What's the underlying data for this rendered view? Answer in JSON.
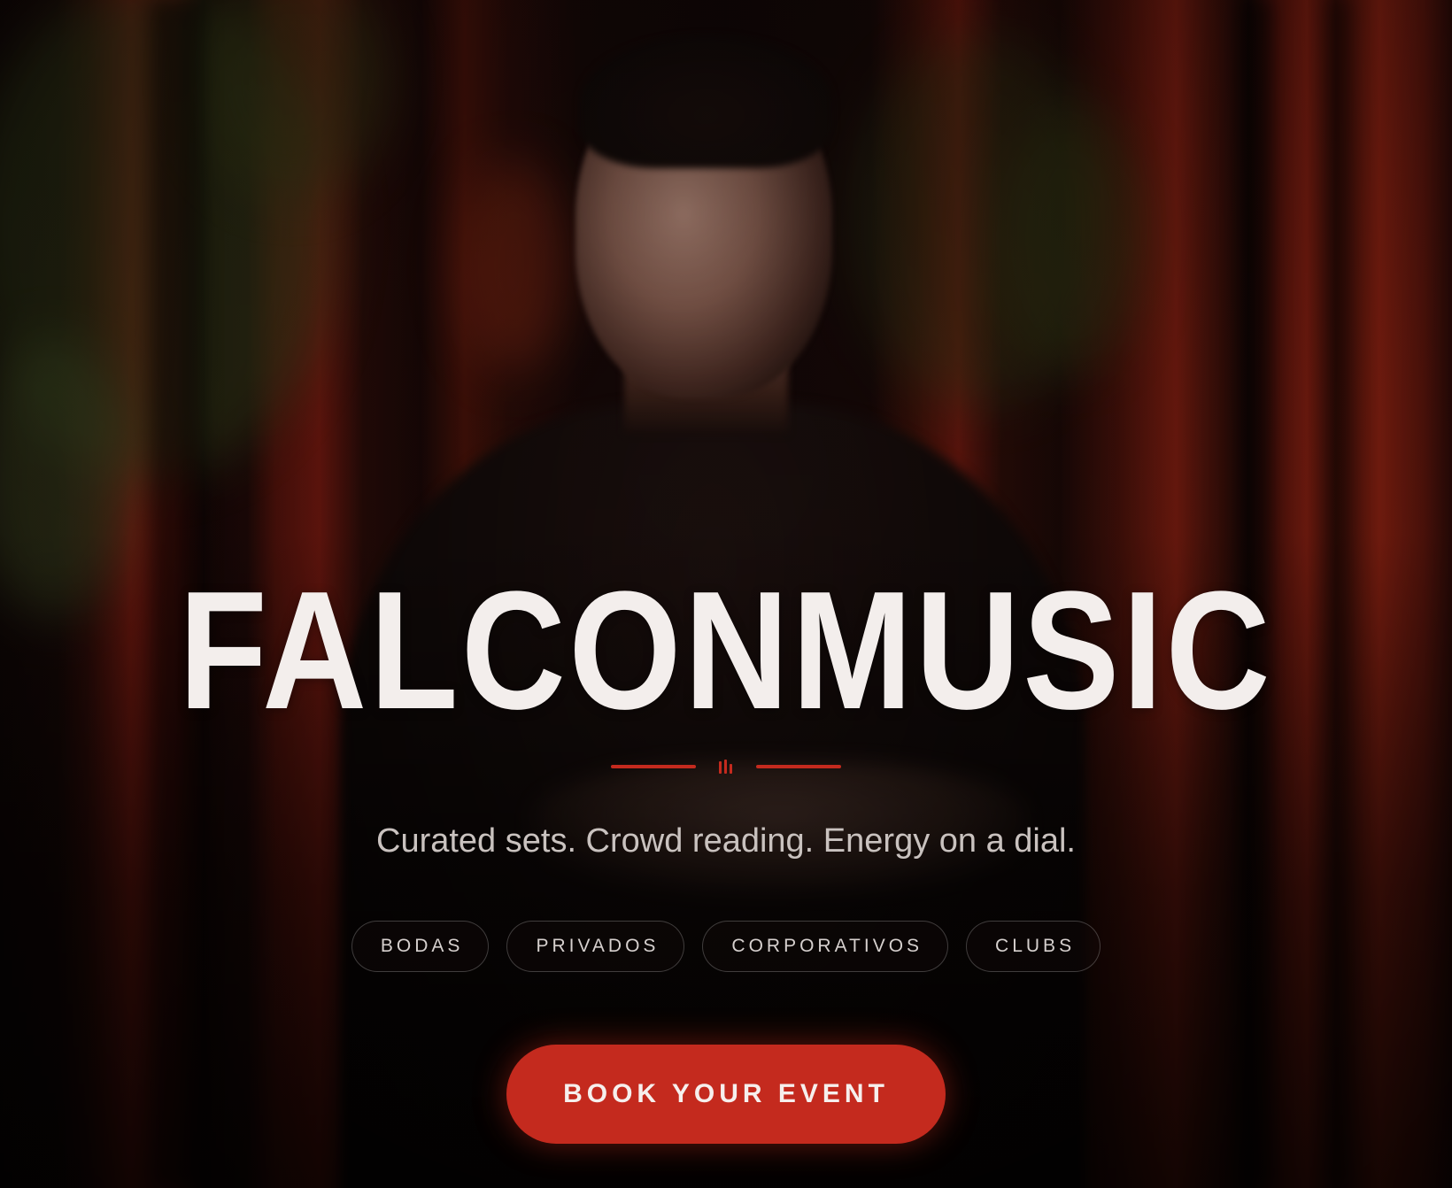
{
  "hero": {
    "title": "FALCONMUSIC",
    "tagline": "Curated sets. Crowd reading. Energy on a dial.",
    "divider_icon": "equalizer-icon",
    "categories": [
      {
        "label": "BODAS"
      },
      {
        "label": "PRIVADOS"
      },
      {
        "label": "CORPORATIVOS"
      },
      {
        "label": "CLUBS"
      }
    ],
    "cta_label": "BOOK YOUR EVENT"
  },
  "colors": {
    "accent": "#c42a1e",
    "title_text": "#f3eeec",
    "tagline_text": "#c9c2bf",
    "background": "#0c0606"
  }
}
